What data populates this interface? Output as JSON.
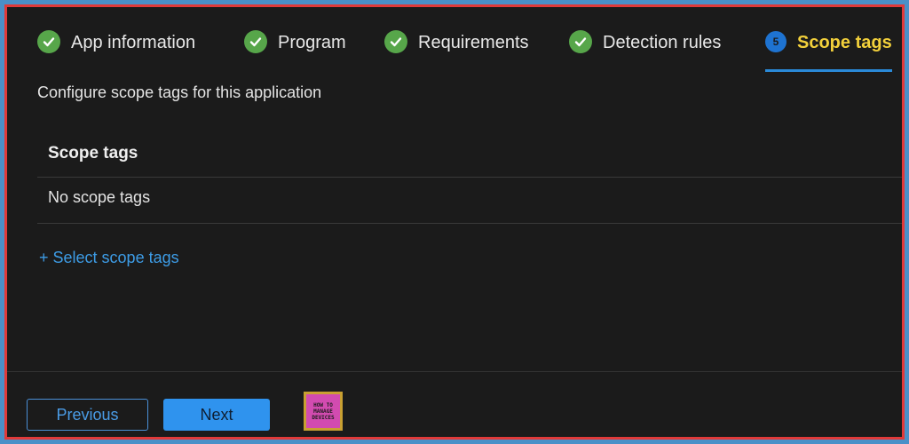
{
  "wizard": {
    "steps": [
      {
        "label": "App information",
        "state": "complete",
        "icon": "check-icon"
      },
      {
        "label": "Program",
        "state": "complete",
        "icon": "check-icon"
      },
      {
        "label": "Requirements",
        "state": "complete",
        "icon": "check-icon"
      },
      {
        "label": "Detection rules",
        "state": "complete",
        "icon": "check-icon"
      },
      {
        "label": "Scope tags",
        "state": "active",
        "number": "5"
      }
    ]
  },
  "main": {
    "description": "Configure scope tags for this application",
    "table": {
      "header": "Scope tags",
      "rows": [
        "No scope tags"
      ]
    },
    "select_link": "+ Select scope tags"
  },
  "footer": {
    "previous_label": "Previous",
    "next_label": "Next",
    "logo": {
      "line1": "HOW TO",
      "line2": "MANAGE",
      "line3": "DEVICES"
    }
  },
  "colors": {
    "background": "#1b1b1b",
    "accent": "#2f93ee",
    "active_step": "#f2d03b",
    "complete_check": "#57a64a"
  }
}
